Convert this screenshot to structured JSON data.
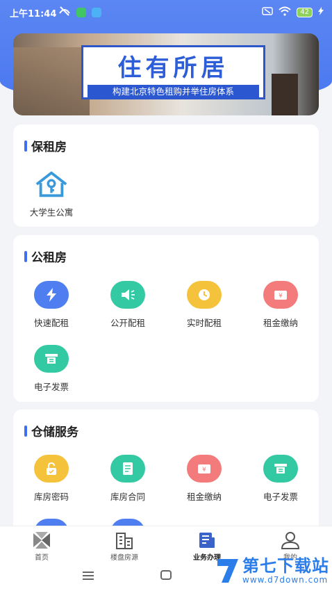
{
  "status_bar": {
    "time": "上午11:44",
    "battery": "42",
    "icons": [
      "muted-icon",
      "wechat-icon",
      "upload-icon",
      "sim-icon",
      "wifi-icon",
      "battery-icon",
      "charging-icon"
    ]
  },
  "banner": {
    "title": "住有所居",
    "subtitle": "构建北京特色租购并举住房体系"
  },
  "sections": [
    {
      "title": "保租房",
      "items": [
        {
          "label": "大学生公寓",
          "icon": "house-key-icon"
        }
      ]
    },
    {
      "title": "公租房",
      "items": [
        {
          "label": "快速配租",
          "icon": "lightning-icon",
          "color": "#4f7ef0"
        },
        {
          "label": "公开配租",
          "icon": "megaphone-icon",
          "color": "#33c9a2"
        },
        {
          "label": "实时配租",
          "icon": "clock-icon",
          "color": "#f5c33b"
        },
        {
          "label": "租金缴纳",
          "icon": "yuan-wallet-icon",
          "color": "#f47b7b"
        },
        {
          "label": "电子发票",
          "icon": "invoice-icon",
          "color": "#33c9a2"
        }
      ]
    },
    {
      "title": "仓储服务",
      "items": [
        {
          "label": "库房密码",
          "icon": "lock-icon",
          "color": "#f5c33b"
        },
        {
          "label": "库房合同",
          "icon": "contract-icon",
          "color": "#33c9a2"
        },
        {
          "label": "租金缴纳",
          "icon": "yuan-wallet-icon",
          "color": "#f47b7b"
        },
        {
          "label": "电子发票",
          "icon": "invoice-icon",
          "color": "#33c9a2"
        }
      ]
    }
  ],
  "tabs": [
    {
      "label": "首页",
      "icon": "home-icon"
    },
    {
      "label": "楼盘房源",
      "icon": "building-icon"
    },
    {
      "label": "业务办理",
      "icon": "business-icon",
      "active": true
    },
    {
      "label": "我的",
      "icon": "profile-icon"
    }
  ],
  "watermark": {
    "text": "第七下载站",
    "url": "www.d7down.com"
  }
}
